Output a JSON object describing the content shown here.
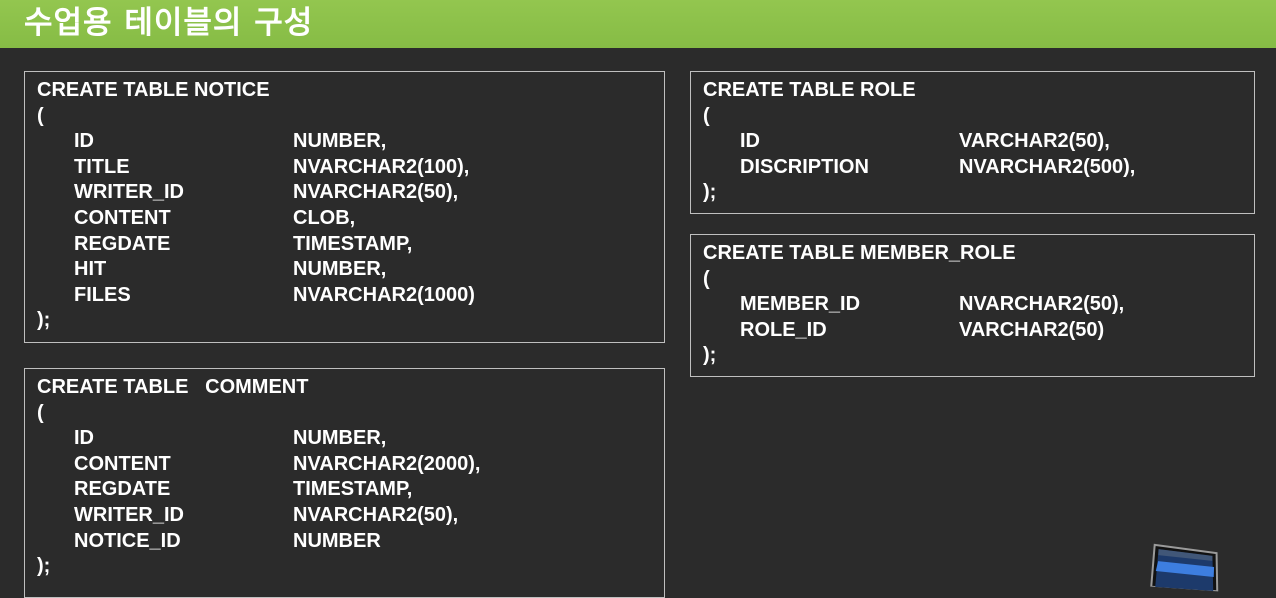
{
  "slide": {
    "title": "수업용 테이블의 구성"
  },
  "tables": {
    "notice": {
      "header": "CREATE TABLE NOTICE",
      "open": "(",
      "close": ");",
      "columns": [
        {
          "name": "ID",
          "type": "NUMBER,"
        },
        {
          "name": "TITLE",
          "type": "NVARCHAR2(100),"
        },
        {
          "name": "WRITER_ID",
          "type": "NVARCHAR2(50),"
        },
        {
          "name": "CONTENT",
          "type": "CLOB,"
        },
        {
          "name": "REGDATE",
          "type": "TIMESTAMP,"
        },
        {
          "name": "HIT",
          "type": "NUMBER,"
        },
        {
          "name": "FILES",
          "type": "NVARCHAR2(1000)"
        }
      ]
    },
    "comment": {
      "header": "CREATE TABLE   COMMENT",
      "open": "(",
      "close": ");",
      "columns": [
        {
          "name": "ID",
          "type": "NUMBER,"
        },
        {
          "name": "CONTENT",
          "type": "NVARCHAR2(2000),"
        },
        {
          "name": "REGDATE",
          "type": "TIMESTAMP,"
        },
        {
          "name": "WRITER_ID",
          "type": "NVARCHAR2(50),"
        },
        {
          "name": "NOTICE_ID",
          "type": "NUMBER"
        }
      ]
    },
    "role": {
      "header": "CREATE TABLE ROLE",
      "open": "(",
      "close": ");",
      "columns": [
        {
          "name": "ID",
          "type": "VARCHAR2(50),"
        },
        {
          "name": "DISCRIPTION",
          "type": "NVARCHAR2(500),"
        }
      ]
    },
    "member_role": {
      "header": "CREATE TABLE MEMBER_ROLE",
      "open": "(",
      "close": ");",
      "columns": [
        {
          "name": "MEMBER_ID",
          "type": "NVARCHAR2(50),"
        },
        {
          "name": "ROLE_ID",
          "type": "VARCHAR2(50)"
        }
      ]
    }
  },
  "colors": {
    "background": "#2b2b2b",
    "title_bar": "#8bc34a",
    "text": "#ffffff",
    "box_border": "#bfbfbf"
  }
}
